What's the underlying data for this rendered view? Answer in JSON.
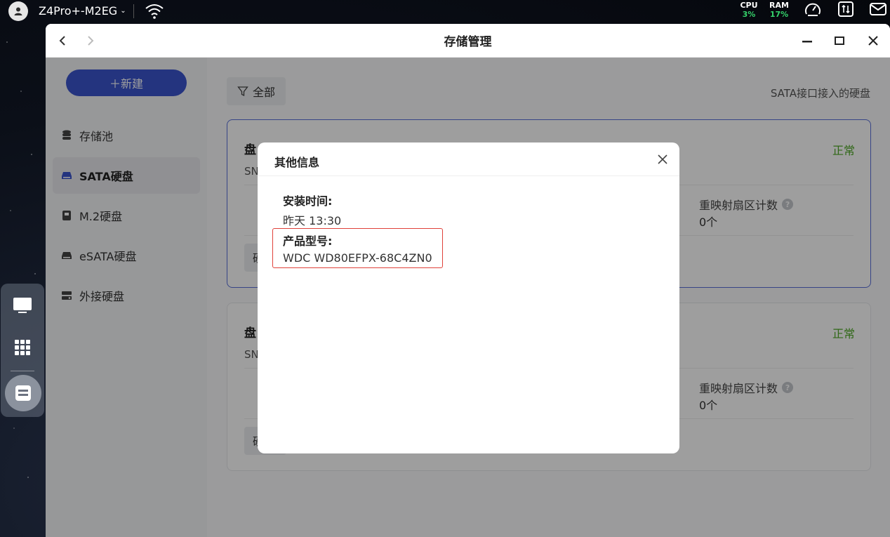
{
  "topbar": {
    "device_name": "Z4Pro+-M2EG",
    "cpu_label": "CPU",
    "cpu_value": "3%",
    "ram_label": "RAM",
    "ram_value": "17%",
    "colors": {
      "meter_value": "#35d36b"
    }
  },
  "window": {
    "title": "存储管理"
  },
  "sidebar": {
    "new_button": "＋新建",
    "items": [
      {
        "label": "存储池",
        "icon": "database-icon"
      },
      {
        "label": "SATA硬盘",
        "icon": "hdd-icon"
      },
      {
        "label": "M.2硬盘",
        "icon": "m2-icon"
      },
      {
        "label": "eSATA硬盘",
        "icon": "hdd-icon"
      },
      {
        "label": "外接硬盘",
        "icon": "external-drive-icon"
      }
    ],
    "active_index": 1
  },
  "main": {
    "filter_label": "全部",
    "hint": "SATA接口接入的硬盘",
    "disks": [
      {
        "name": "盘",
        "sn": "SN",
        "status": "正常",
        "remap_label": "重映射扇区计数",
        "remap_value": "0个",
        "action": "硬"
      },
      {
        "name": "盘",
        "sn": "SN",
        "status": "正常",
        "remap_label": "重映射扇区计数",
        "remap_value": "0个",
        "action": "硬"
      }
    ],
    "colors": {
      "status_ok": "#4ea826",
      "accent": "#3a54ce"
    }
  },
  "modal": {
    "title": "其他信息",
    "install_label": "安装时间:",
    "install_value": "昨天 13:30",
    "model_label": "产品型号:",
    "model_value": "WDC WD80EFPX-68C4ZN0",
    "colors": {
      "highlight_border": "#e0413a"
    }
  }
}
